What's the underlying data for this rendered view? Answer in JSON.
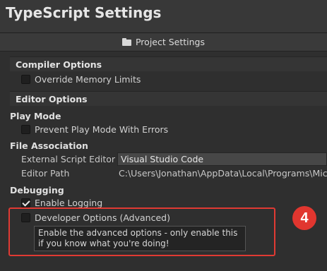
{
  "window": {
    "title": "TypeScript Settings"
  },
  "header": {
    "label": "Project Settings",
    "icon": "folder-icon"
  },
  "compiler": {
    "title": "Compiler Options",
    "override_memory_limits": {
      "label": "Override Memory Limits",
      "checked": false
    }
  },
  "editor": {
    "title": "Editor Options",
    "play_mode": {
      "title": "Play Mode",
      "prevent_play_mode": {
        "label": "Prevent Play Mode With Errors",
        "checked": false
      }
    },
    "file_association": {
      "title": "File Association",
      "external_editor_label": "External Script Editor",
      "external_editor_value": "Visual Studio Code",
      "editor_path_label": "Editor Path",
      "editor_path_value": "C:\\Users\\Jonathan\\AppData\\Local\\Programs\\Micros"
    },
    "debugging": {
      "title": "Debugging",
      "enable_logging": {
        "label": "Enable Logging",
        "checked": true
      },
      "developer_options": {
        "label": "Developer Options (Advanced)",
        "checked": false
      }
    }
  },
  "tooltip": {
    "text": "Enable the advanced options - only enable this if you know what you're doing!"
  },
  "annotation": {
    "number": "4",
    "color": "#e1362f"
  }
}
